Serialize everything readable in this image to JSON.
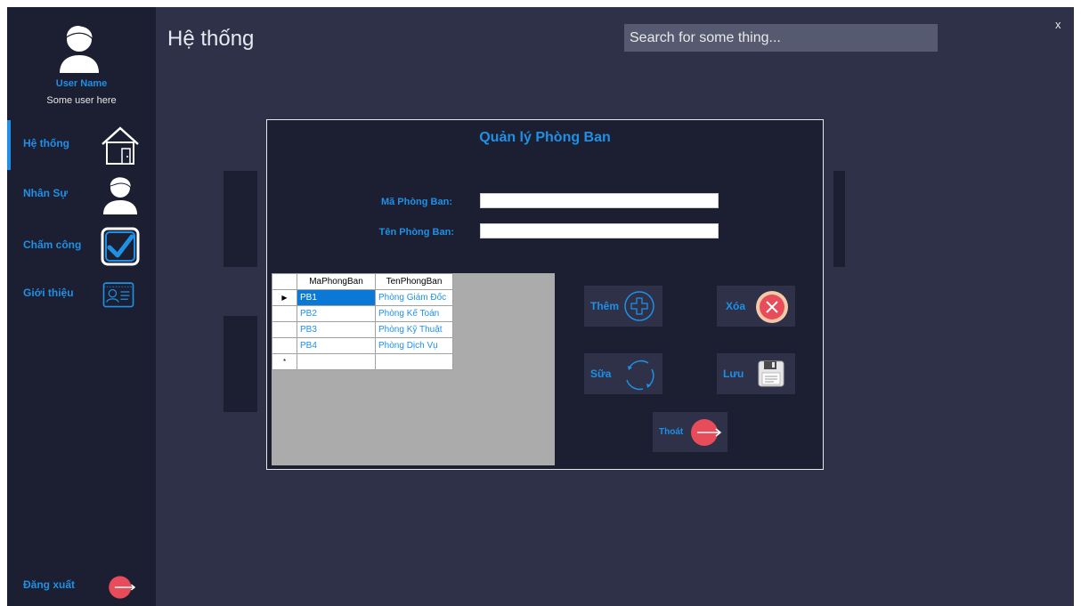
{
  "sidebar": {
    "user_name": "User Name",
    "user_subtitle": "Some user here",
    "items": [
      {
        "label": "Hệ thống",
        "icon": "home-icon"
      },
      {
        "label": "Nhân Sự",
        "icon": "person-icon"
      },
      {
        "label": "Chấm công",
        "icon": "checkbox-icon"
      },
      {
        "label": "Giới thiệu",
        "icon": "id-card-icon"
      }
    ],
    "logout_label": "Đăng xuất",
    "logout_icon": "logout-icon"
  },
  "header": {
    "title": "Hệ thống",
    "search_placeholder": "Search for some thing...",
    "close_label": "x"
  },
  "dialog": {
    "title": "Quản lý Phòng Ban",
    "fields": {
      "ma_label": "Mã Phòng Ban:",
      "ma_value": "",
      "ten_label": "Tên Phòng Ban:",
      "ten_value": ""
    },
    "grid": {
      "columns": [
        "MaPhongBan",
        "TenPhongBan"
      ],
      "rows": [
        [
          "PB1",
          "Phòng Giám Đốc"
        ],
        [
          "PB2",
          "Phòng Kế Toán"
        ],
        [
          "PB3",
          "Phòng Kỹ Thuật"
        ],
        [
          "PB4",
          "Phòng Dịch Vụ"
        ]
      ],
      "current_row_marker": "▶",
      "new_row_marker": "*"
    },
    "buttons": {
      "add": "Thêm",
      "delete": "Xóa",
      "edit": "Sữa",
      "save": "Lưu",
      "exit": "Thoát"
    }
  },
  "colors": {
    "accent": "#1e90e6",
    "sidebar_bg": "#1c1f31",
    "content_bg": "#2e3148",
    "danger": "#e84c5a"
  }
}
